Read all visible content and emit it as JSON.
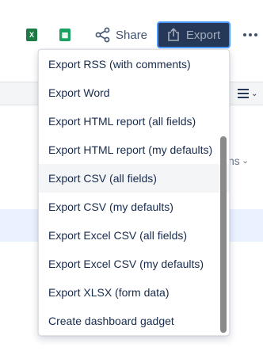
{
  "toolbar": {
    "excel_icon": "excel-icon",
    "sheets_icon": "google-sheets-icon",
    "share_label": "Share",
    "export_label": "Export",
    "more_icon": "more-horizontal-icon"
  },
  "background": {
    "peek_text": "ns"
  },
  "export_menu": {
    "items": [
      {
        "label": "Export RSS (with comments)"
      },
      {
        "label": "Export Word"
      },
      {
        "label": "Export HTML report (all fields)"
      },
      {
        "label": "Export HTML report (my defaults)"
      },
      {
        "label": "Export CSV (all fields)"
      },
      {
        "label": "Export CSV (my defaults)"
      },
      {
        "label": "Export Excel CSV (all fields)"
      },
      {
        "label": "Export Excel CSV (my defaults)"
      },
      {
        "label": "Export XLSX (form data)"
      },
      {
        "label": "Create dashboard gadget"
      }
    ],
    "hovered_item": "Export CSV (all fields)"
  },
  "colors": {
    "export_button_bg": "#253858",
    "export_button_focus": "#4c9aff",
    "selected_row_bg": "#ebf2ff"
  }
}
